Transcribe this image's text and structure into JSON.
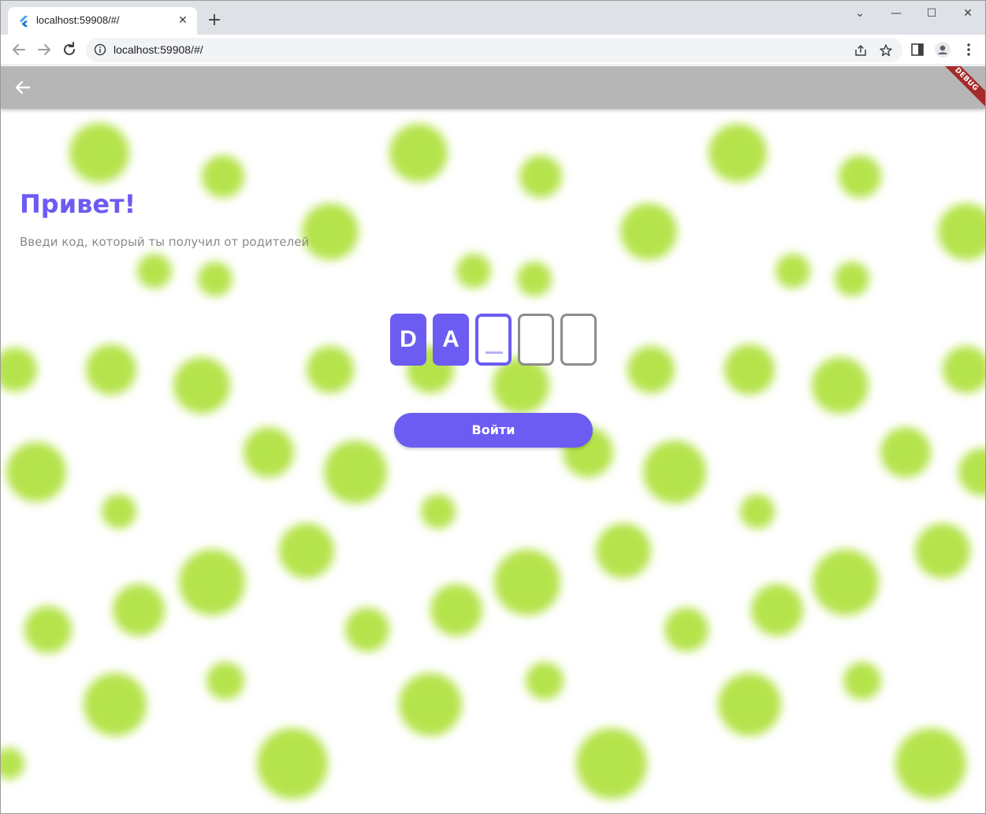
{
  "browser": {
    "tab_title": "localhost:59908/#/",
    "tab_close": "✕",
    "new_tab": "+",
    "url": "localhost:59908/#/",
    "window_controls": {
      "dropdown": "⌄",
      "minimize": "—",
      "maximize": "☐",
      "close": "✕"
    }
  },
  "app": {
    "debug_banner": "DEBUG",
    "greeting": "Привет!",
    "subtitle": "Введи код, который ты получил от родителей",
    "code": [
      {
        "char": "D",
        "state": "filled"
      },
      {
        "char": "A",
        "state": "filled"
      },
      {
        "char": "",
        "state": "active"
      },
      {
        "char": "",
        "state": "empty"
      },
      {
        "char": "",
        "state": "empty"
      }
    ],
    "login_label": "Войти"
  },
  "colors": {
    "accent": "#6c5cf2",
    "appbar": "#b6b6b6",
    "dots": "#b5e34b",
    "empty_border": "#8c8c8c"
  },
  "icons": [
    "flutter-favicon",
    "back-arrow-icon",
    "forward-arrow-icon",
    "reload-icon",
    "info-icon",
    "share-icon",
    "star-icon",
    "sidebar-icon",
    "profile-icon",
    "menu-dots-icon"
  ]
}
